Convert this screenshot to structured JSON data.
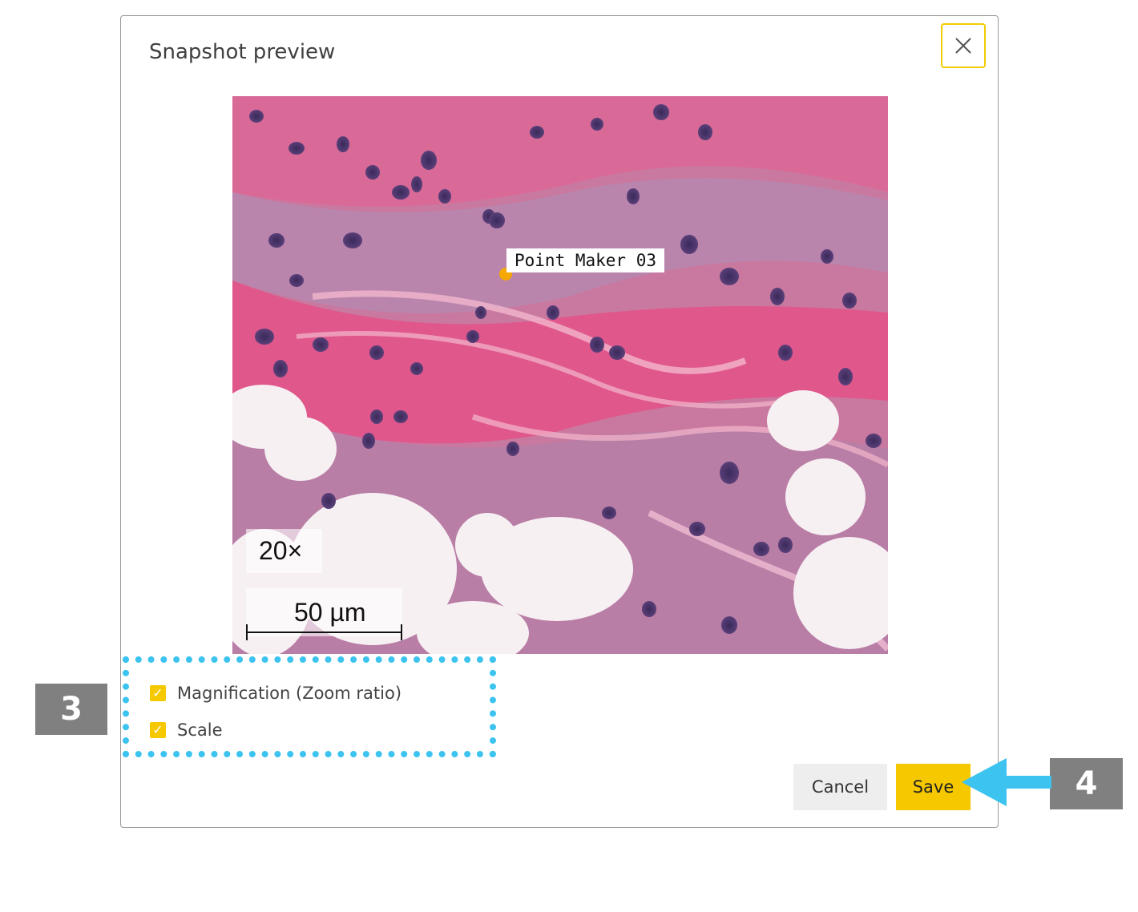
{
  "dialog": {
    "title": "Snapshot preview",
    "close_icon": "close-icon"
  },
  "snapshot": {
    "point_marker_label": "Point Maker 03",
    "magnification_text": "20×",
    "scale_text": "50 µm",
    "marker_color": "#f5a800"
  },
  "options": [
    {
      "label": "Magnification (Zoom ratio)",
      "checked": true
    },
    {
      "label": "Scale",
      "checked": true
    }
  ],
  "buttons": {
    "cancel_label": "Cancel",
    "save_label": "Save"
  },
  "annotations": {
    "step_3": "3",
    "step_4": "4",
    "highlight_color": "#3cc3f0",
    "badge_color": "#808080"
  },
  "colors": {
    "accent": "#f5c800"
  }
}
